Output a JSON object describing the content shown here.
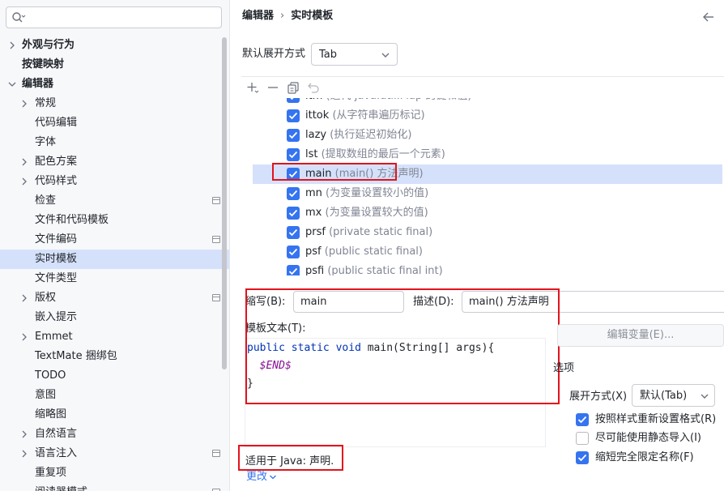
{
  "search": {
    "placeholder": ""
  },
  "sidebar": {
    "items": [
      {
        "label": "外观与行为",
        "level": 0,
        "bold": true,
        "chevron": "right",
        "marker": false
      },
      {
        "label": "按键映射",
        "level": 0,
        "bold": true,
        "chevron": "none",
        "marker": false
      },
      {
        "label": "编辑器",
        "level": 0,
        "bold": true,
        "chevron": "down",
        "marker": false
      },
      {
        "label": "常规",
        "level": 1,
        "chevron": "right",
        "marker": false
      },
      {
        "label": "代码编辑",
        "level": 1,
        "chevron": "none",
        "marker": false
      },
      {
        "label": "字体",
        "level": 1,
        "chevron": "none",
        "marker": false
      },
      {
        "label": "配色方案",
        "level": 1,
        "chevron": "right",
        "marker": false
      },
      {
        "label": "代码样式",
        "level": 1,
        "chevron": "right",
        "marker": false
      },
      {
        "label": "检查",
        "level": 1,
        "chevron": "none",
        "marker": true
      },
      {
        "label": "文件和代码模板",
        "level": 1,
        "chevron": "none",
        "marker": false
      },
      {
        "label": "文件编码",
        "level": 1,
        "chevron": "none",
        "marker": true
      },
      {
        "label": "实时模板",
        "level": 1,
        "chevron": "none",
        "marker": false,
        "selected": true
      },
      {
        "label": "文件类型",
        "level": 1,
        "chevron": "none",
        "marker": false
      },
      {
        "label": "版权",
        "level": 1,
        "chevron": "right",
        "marker": true
      },
      {
        "label": "嵌入提示",
        "level": 1,
        "chevron": "none",
        "marker": false
      },
      {
        "label": "Emmet",
        "level": 1,
        "chevron": "right",
        "marker": false
      },
      {
        "label": "TextMate 捆绑包",
        "level": 1,
        "chevron": "none",
        "marker": false
      },
      {
        "label": "TODO",
        "level": 1,
        "chevron": "none",
        "marker": false
      },
      {
        "label": "意图",
        "level": 1,
        "chevron": "none",
        "marker": false
      },
      {
        "label": "缩略图",
        "level": 1,
        "chevron": "none",
        "marker": false
      },
      {
        "label": "自然语言",
        "level": 1,
        "chevron": "right",
        "marker": false
      },
      {
        "label": "语言注入",
        "level": 1,
        "chevron": "right",
        "marker": true
      },
      {
        "label": "重复项",
        "level": 1,
        "chevron": "none",
        "marker": false
      },
      {
        "label": "阅读器模式",
        "level": 1,
        "chevron": "none",
        "marker": true
      }
    ]
  },
  "breadcrumb": {
    "parent": "编辑器",
    "separator": "›",
    "current": "实时模板"
  },
  "default_expand": {
    "label": "默认展开方式",
    "value": "Tab"
  },
  "templates": [
    {
      "abbr": "itm",
      "desc": "(迭代 java.util.Map 的键和值)",
      "checked": true
    },
    {
      "abbr": "ittok",
      "desc": "(从字符串遍历标记)",
      "checked": true
    },
    {
      "abbr": "lazy",
      "desc": "(执行延迟初始化)",
      "checked": true
    },
    {
      "abbr": "lst",
      "desc": "(提取数组的最后一个元素)",
      "checked": true
    },
    {
      "abbr": "main",
      "desc": "(main() 方法声明)",
      "checked": true,
      "selected": true
    },
    {
      "abbr": "mn",
      "desc": "(为变量设置较小的值)",
      "checked": true
    },
    {
      "abbr": "mx",
      "desc": "(为变量设置较大的值)",
      "checked": true
    },
    {
      "abbr": "prsf",
      "desc": "(private static final)",
      "checked": true
    },
    {
      "abbr": "psf",
      "desc": "(public static final)",
      "checked": true
    },
    {
      "abbr": "psfi",
      "desc": "(public static final int)",
      "checked": true
    }
  ],
  "editor": {
    "abbr_label": "缩写(B):",
    "abbr_value": "main",
    "desc_label": "描述(D):",
    "desc_value": "main() 方法声明",
    "template_label": "模板文本(T):",
    "code": {
      "line1_kw1": "public",
      "line1_kw2": "static",
      "line1_kw3": "void",
      "line1_rest": " main(String[] args){",
      "line2_var": "$END$",
      "line3": "}"
    },
    "edit_vars": "编辑变量(E)...",
    "options_title": "选项",
    "expand_label": "展开方式(X)",
    "expand_value": "默认(Tab)",
    "opt_reformat": "按照样式重新设置格式(R)",
    "opt_reformat_checked": true,
    "opt_static": "尽可能使用静态导入(I)",
    "opt_static_checked": false,
    "opt_shorten": "缩短完全限定名称(F)",
    "opt_shorten_checked": true,
    "applies": "适用于 Java: 声明.",
    "change": "更改"
  },
  "colors": {
    "accent": "#3574f0",
    "selection": "#d5e1fb",
    "highlight": "#e3131c"
  }
}
